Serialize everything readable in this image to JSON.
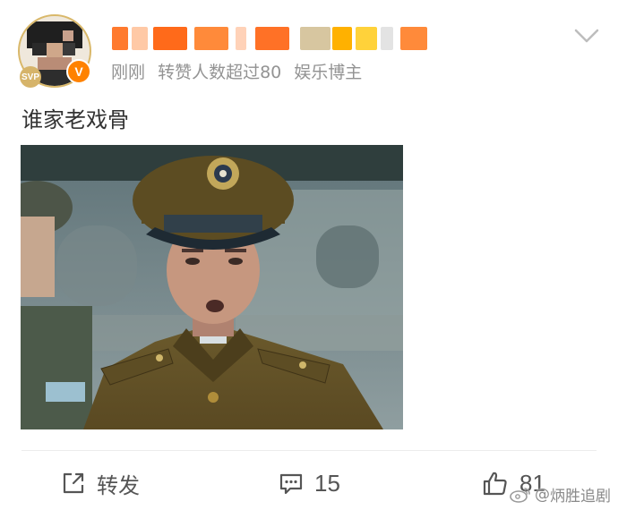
{
  "post": {
    "meta": {
      "time": "刚刚",
      "stat": "转赞人数超过80",
      "role": "娱乐博主"
    },
    "level_badge": "SVP",
    "verified_badge": "V",
    "text": "谁家老戏骨"
  },
  "actions": {
    "repost_label": "转发",
    "comment_count": "15",
    "like_count": "81"
  },
  "watermark": {
    "text": "炳胜追剧"
  },
  "colors": {
    "brand_orange": "#ff8200",
    "meta_gray": "#939393",
    "text_dark": "#333333"
  },
  "icons": {
    "repost": "share-arrow-icon",
    "comment": "comment-bubble-icon",
    "like": "thumbs-up-icon",
    "more": "chevron-down-icon",
    "watermark": "weibo-logo-icon"
  }
}
